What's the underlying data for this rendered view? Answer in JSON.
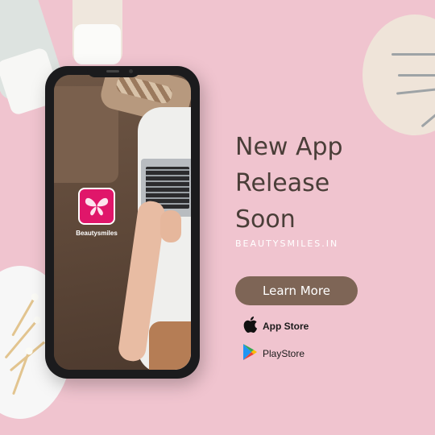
{
  "app": {
    "icon": "butterfly-icon",
    "label": "Beautysmiles",
    "accent": "#e0166a"
  },
  "headline": [
    "New App",
    "Release",
    "Soon"
  ],
  "domain": "BEAUTYSMILES.IN",
  "cta": {
    "label": "Learn More",
    "color": "#7e6556"
  },
  "stores": [
    {
      "icon": "apple-icon",
      "label": "App Store"
    },
    {
      "icon": "google-play-icon",
      "label": "PlayStore"
    }
  ],
  "colors": {
    "background": "#f0c4cf",
    "headline": "#4a3e38"
  }
}
